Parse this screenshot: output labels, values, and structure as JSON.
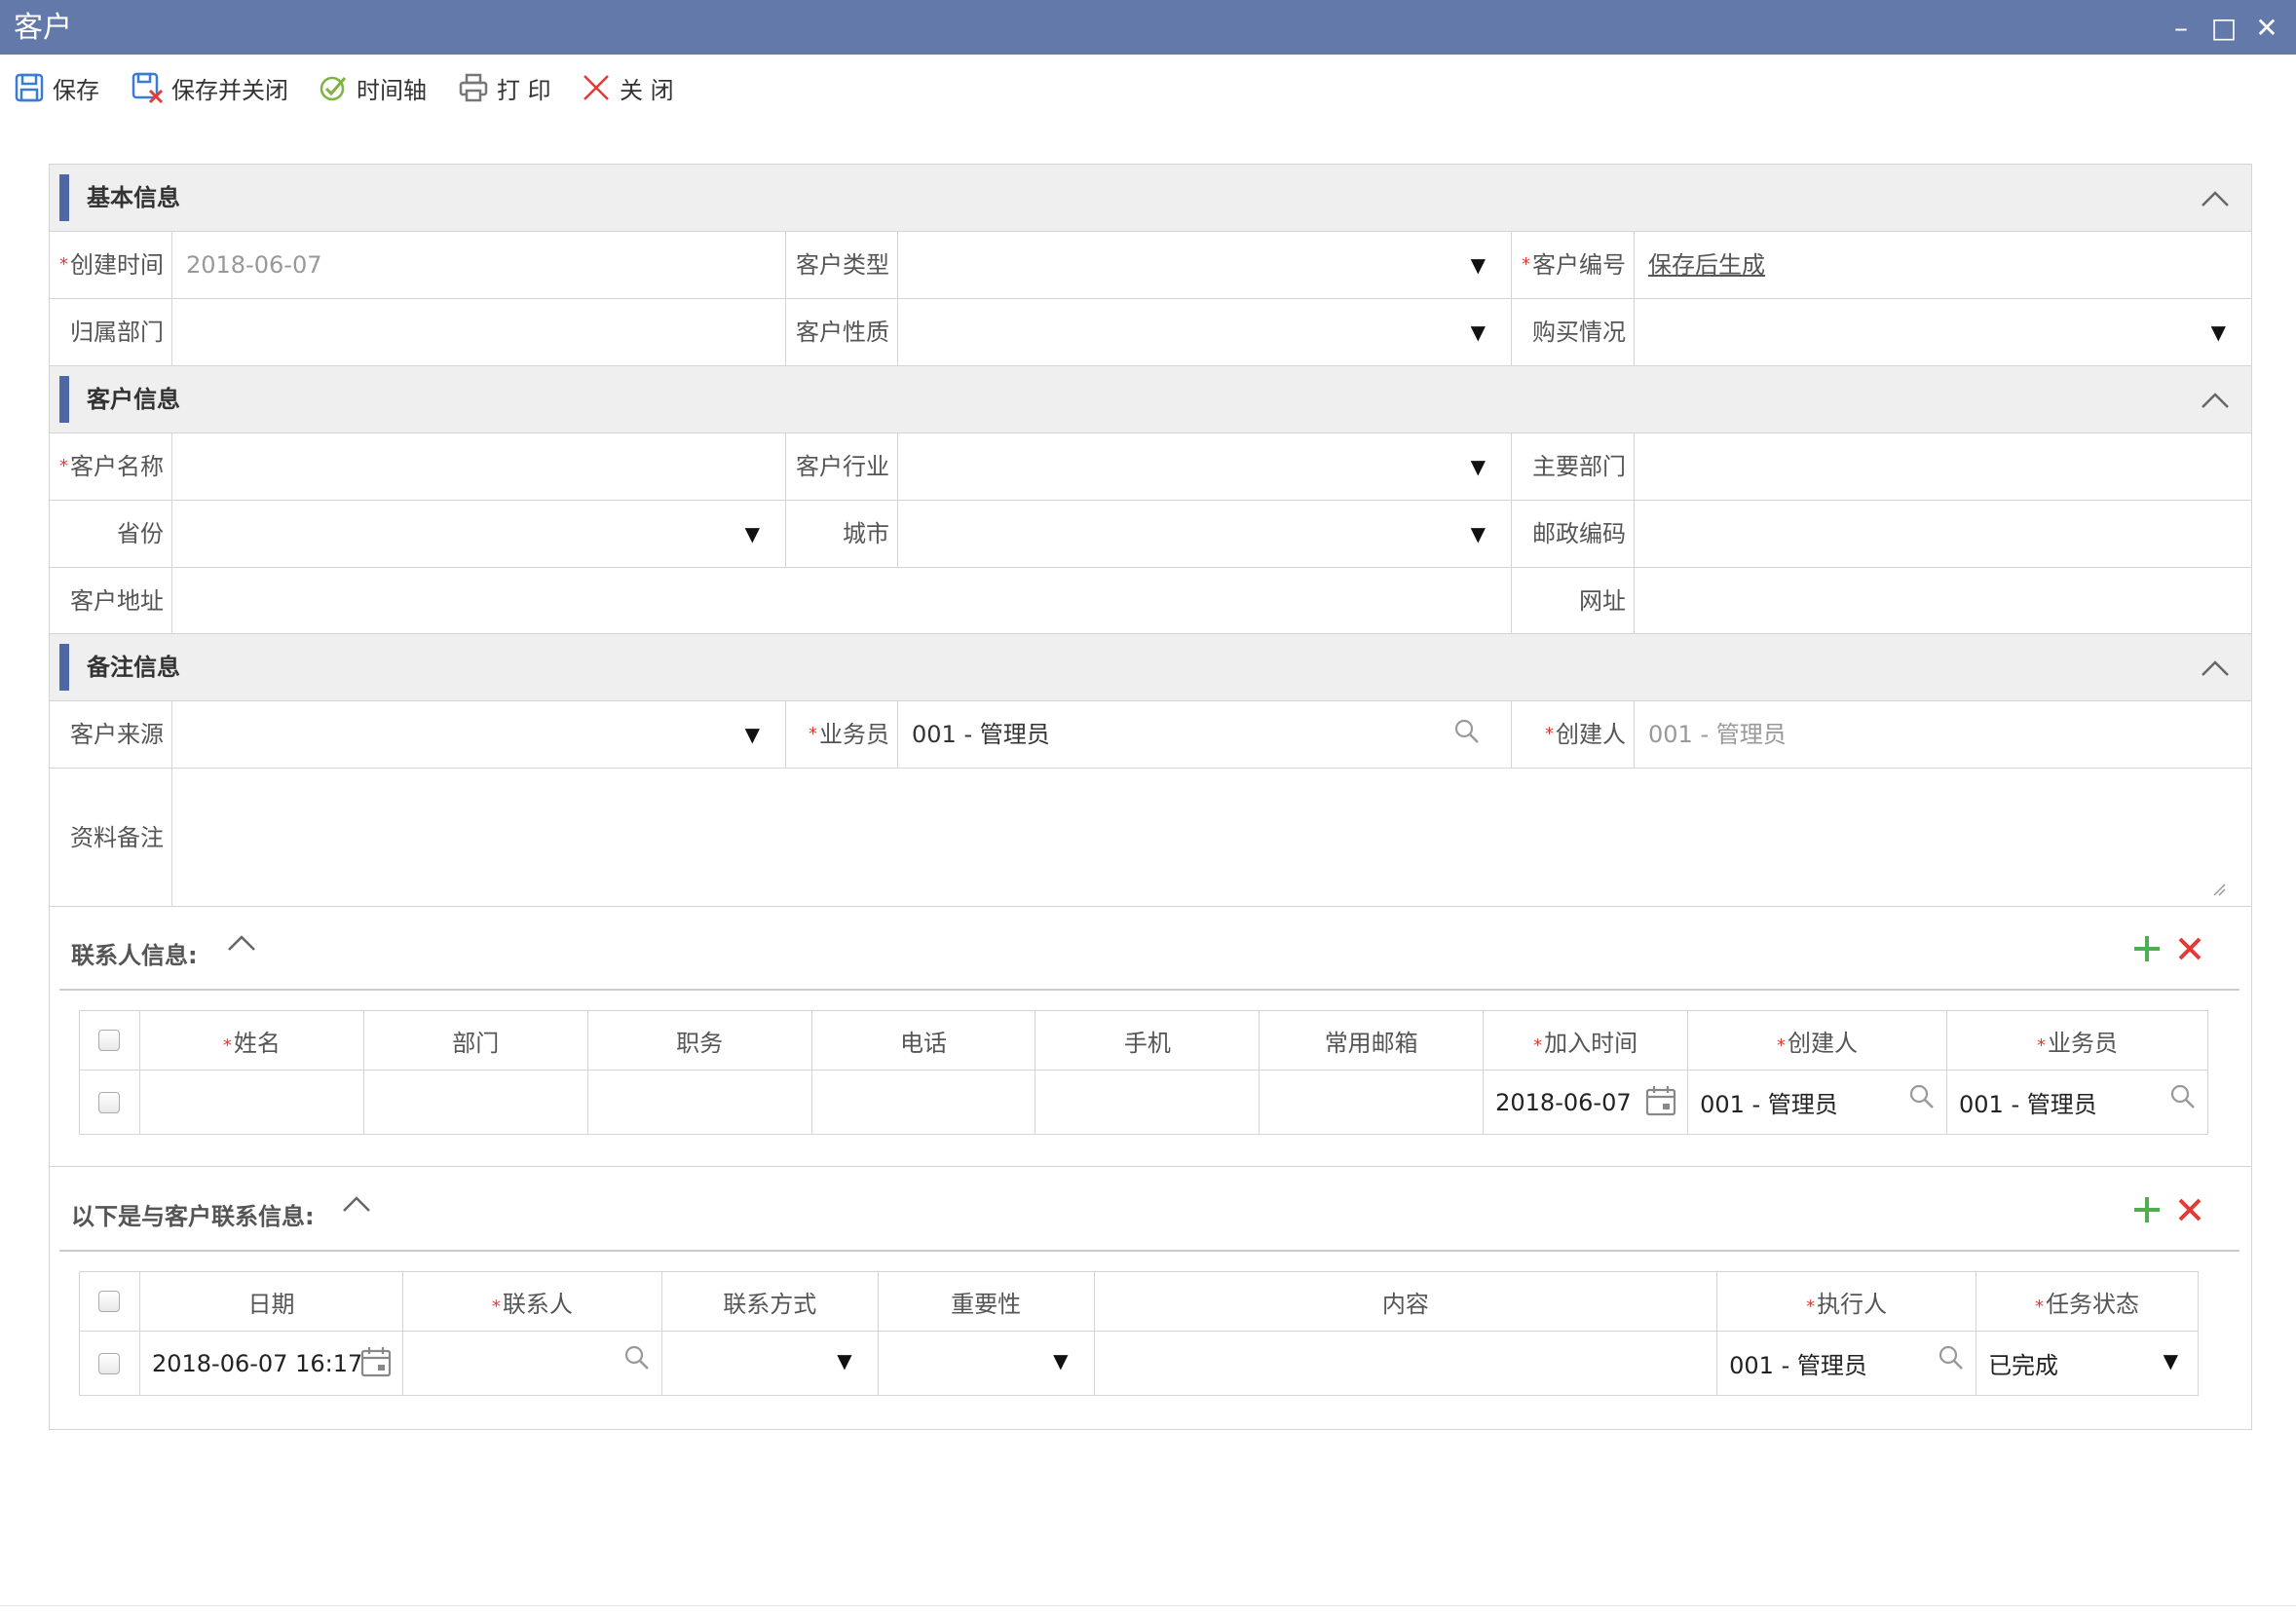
{
  "window": {
    "title": "客户",
    "minimize": "–",
    "maximize": "□",
    "close": "✕"
  },
  "toolbar": {
    "save": "保存",
    "save_close": "保存并关闭",
    "timeline": "时间轴",
    "print": "打 印",
    "close": "关 闭"
  },
  "sections": {
    "basic": "基本信息",
    "customer": "客户信息",
    "remarks": "备注信息"
  },
  "basic": {
    "created_time_label": "创建时间",
    "created_time_value": "2018-06-07",
    "customer_type_label": "客户类型",
    "customer_no_label": "客户编号",
    "customer_no_value": "保存后生成",
    "dept_label": "归属部门",
    "nature_label": "客户性质",
    "purchase_label": "购买情况"
  },
  "customer": {
    "name_label": "客户名称",
    "industry_label": "客户行业",
    "main_dept_label": "主要部门",
    "province_label": "省份",
    "city_label": "城市",
    "postcode_label": "邮政编码",
    "address_label": "客户地址",
    "website_label": "网址"
  },
  "remarks": {
    "source_label": "客户来源",
    "salesman_label": "业务员",
    "salesman_value": "001 - 管理员",
    "creator_label": "创建人",
    "creator_value": "001 - 管理员",
    "notes_label": "资料备注"
  },
  "contacts": {
    "title": "联系人信息:",
    "columns": [
      "姓名",
      "部门",
      "职务",
      "电话",
      "手机",
      "常用邮箱",
      "加入时间",
      "创建人",
      "业务员"
    ],
    "row": {
      "join_time": "2018-06-07",
      "creator": "001 - 管理员",
      "salesman": "001 - 管理员"
    }
  },
  "contact_log": {
    "title": "以下是与客户联系信息:",
    "columns": [
      "日期",
      "联系人",
      "联系方式",
      "重要性",
      "内容",
      "执行人",
      "任务状态"
    ],
    "row": {
      "date": "2018-06-07 16:17",
      "executor": "001 - 管理员",
      "status": "已完成"
    }
  },
  "icons": {
    "save": "floppy-icon",
    "save_close": "save-close-icon",
    "timeline": "check-circle-icon",
    "print": "printer-icon",
    "close": "close-x-icon",
    "add": "plus-icon",
    "delete": "x-icon",
    "search": "search-icon",
    "calendar": "calendar-icon",
    "collapse": "chevron-up-icon"
  },
  "colors": {
    "titlebar": "#6279a9",
    "section_bar": "#4e68a6",
    "required": "#e53935",
    "add": "#4caf50",
    "delete": "#e53935"
  }
}
